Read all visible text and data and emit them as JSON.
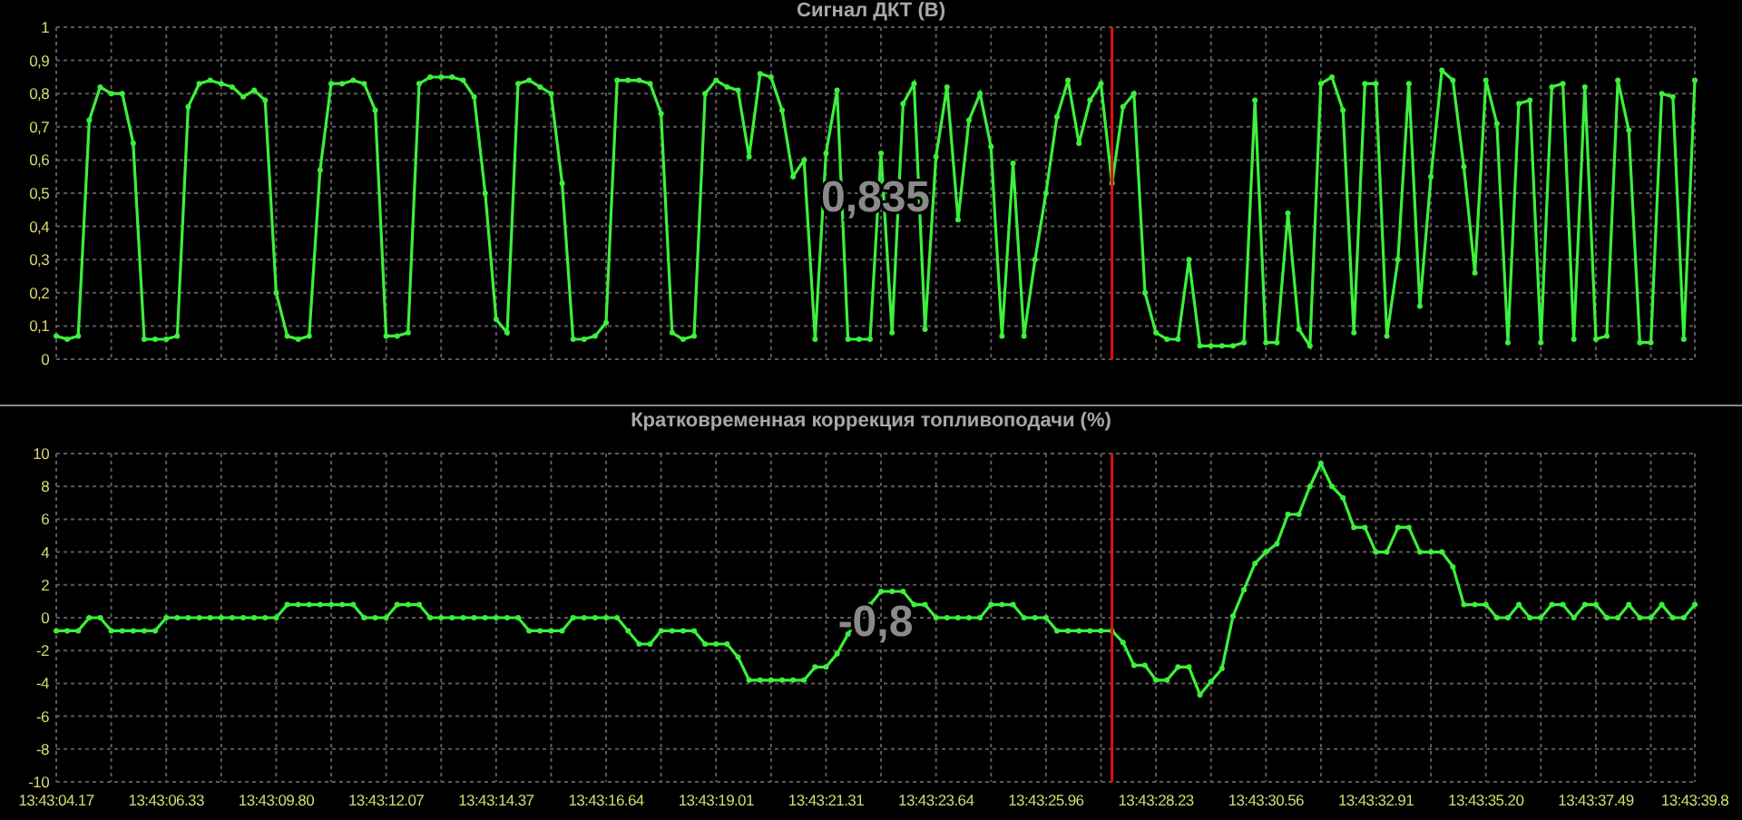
{
  "panels": [
    {
      "readout": "0,835",
      "chart_data": {
        "type": "line",
        "title": "Сигнал ДКТ (В)",
        "grid": true,
        "ylim": [
          0,
          1
        ],
        "yticks": [
          {
            "value": 0,
            "label": "0"
          },
          {
            "value": 0.1,
            "label": "0,1"
          },
          {
            "value": 0.2,
            "label": "0,2"
          },
          {
            "value": 0.3,
            "label": "0,3"
          },
          {
            "value": 0.4,
            "label": "0,4"
          },
          {
            "value": 0.5,
            "label": "0,5"
          },
          {
            "value": 0.6,
            "label": "0,6"
          },
          {
            "value": 0.7,
            "label": "0,7"
          },
          {
            "value": 0.8,
            "label": "0,8"
          },
          {
            "value": 0.9,
            "label": "0,9"
          },
          {
            "value": 1,
            "label": "1"
          }
        ],
        "series": [
          {
            "color": "#3cf03c",
            "marker": "circle",
            "values": [
              0.07,
              0.06,
              0.07,
              0.72,
              0.82,
              0.8,
              0.8,
              0.65,
              0.06,
              0.06,
              0.06,
              0.07,
              0.76,
              0.83,
              0.84,
              0.83,
              0.82,
              0.79,
              0.81,
              0.78,
              0.2,
              0.07,
              0.06,
              0.07,
              0.57,
              0.83,
              0.83,
              0.84,
              0.83,
              0.75,
              0.07,
              0.07,
              0.08,
              0.83,
              0.85,
              0.85,
              0.85,
              0.84,
              0.79,
              0.5,
              0.12,
              0.08,
              0.83,
              0.84,
              0.82,
              0.8,
              0.53,
              0.06,
              0.06,
              0.07,
              0.11,
              0.84,
              0.84,
              0.84,
              0.83,
              0.74,
              0.08,
              0.06,
              0.07,
              0.8,
              0.84,
              0.82,
              0.81,
              0.61,
              0.86,
              0.85,
              0.75,
              0.55,
              0.6,
              0.06,
              0.62,
              0.81,
              0.06,
              0.06,
              0.06,
              0.62,
              0.08,
              0.77,
              0.83,
              0.09,
              0.61,
              0.82,
              0.42,
              0.72,
              0.8,
              0.64,
              0.07,
              0.59,
              0.07,
              0.3,
              0.5,
              0.73,
              0.84,
              0.65,
              0.78,
              0.83,
              0.53,
              0.76,
              0.8,
              0.2,
              0.08,
              0.06,
              0.06,
              0.3,
              0.04,
              0.04,
              0.04,
              0.04,
              0.05,
              0.78,
              0.05,
              0.05,
              0.44,
              0.09,
              0.04,
              0.83,
              0.85,
              0.75,
              0.08,
              0.83,
              0.83,
              0.07,
              0.3,
              0.83,
              0.16,
              0.55,
              0.87,
              0.84,
              0.58,
              0.26,
              0.84,
              0.71,
              0.05,
              0.77,
              0.78,
              0.05,
              0.82,
              0.83,
              0.06,
              0.82,
              0.06,
              0.07,
              0.84,
              0.69,
              0.05,
              0.05,
              0.8,
              0.79,
              0.06,
              0.84
            ]
          }
        ]
      }
    },
    {
      "readout": "-0,8",
      "chart_data": {
        "type": "line",
        "title": "Кратковременная коррекция топливоподачи  (%)",
        "grid": true,
        "ylim": [
          -10,
          10
        ],
        "categories": [
          "13:43:04.17",
          null,
          null,
          null,
          null,
          null,
          null,
          null,
          null,
          null,
          "13:43:06.33",
          null,
          null,
          null,
          null,
          null,
          null,
          null,
          null,
          null,
          "13:43:09.80",
          null,
          null,
          null,
          null,
          null,
          null,
          null,
          null,
          null,
          "13:43:12.07",
          null,
          null,
          null,
          null,
          null,
          null,
          null,
          null,
          null,
          "13:43:14.37",
          null,
          null,
          null,
          null,
          null,
          null,
          null,
          null,
          null,
          "13:43:16.64",
          null,
          null,
          null,
          null,
          null,
          null,
          null,
          null,
          null,
          "13:43:19.01",
          null,
          null,
          null,
          null,
          null,
          null,
          null,
          null,
          null,
          "13:43:21.31",
          null,
          null,
          null,
          null,
          null,
          null,
          null,
          null,
          null,
          "13:43:23.64",
          null,
          null,
          null,
          null,
          null,
          null,
          null,
          null,
          null,
          "13:43:25.96",
          null,
          null,
          null,
          null,
          null,
          null,
          null,
          null,
          null,
          "13:43:28.23",
          null,
          null,
          null,
          null,
          null,
          null,
          null,
          null,
          null,
          "13:43:30.56",
          null,
          null,
          null,
          null,
          null,
          null,
          null,
          null,
          null,
          "13:43:32.91",
          null,
          null,
          null,
          null,
          null,
          null,
          null,
          null,
          null,
          "13:43:35.20",
          null,
          null,
          null,
          null,
          null,
          null,
          null,
          null,
          null,
          "13:43:37.49",
          null,
          null,
          null,
          null,
          null,
          null,
          null,
          null,
          "13:43:39.8"
        ],
        "yticks": [
          10,
          8,
          6,
          4,
          2,
          0,
          -2,
          -4,
          -6,
          -8,
          -10
        ],
        "series": [
          {
            "color": "#3cf03c",
            "marker": "circle",
            "values": [
              -0.8,
              -0.8,
              -0.8,
              0,
              0,
              -0.8,
              -0.8,
              -0.8,
              -0.8,
              -0.8,
              0,
              0,
              0,
              0,
              0,
              0,
              0,
              0,
              0,
              0,
              0,
              0.8,
              0.8,
              0.8,
              0.8,
              0.8,
              0.8,
              0.8,
              0,
              0,
              0,
              0.8,
              0.8,
              0.8,
              0,
              0,
              0,
              0,
              0,
              0,
              0,
              0,
              0,
              -0.8,
              -0.8,
              -0.8,
              -0.8,
              0,
              0,
              0,
              0,
              0,
              -0.8,
              -1.6,
              -1.6,
              -0.8,
              -0.8,
              -0.8,
              -0.8,
              -1.6,
              -1.6,
              -1.6,
              -2.4,
              -3.8,
              -3.8,
              -3.8,
              -3.8,
              -3.8,
              -3.8,
              -3,
              -3,
              -2.2,
              -1,
              0,
              0.8,
              1.6,
              1.6,
              1.6,
              0.8,
              0.8,
              0,
              0,
              0,
              0,
              0,
              0.8,
              0.8,
              0.8,
              0,
              0,
              0,
              -0.8,
              -0.8,
              -0.8,
              -0.8,
              -0.8,
              -0.8,
              -1.5,
              -2.9,
              -2.9,
              -3.8,
              -3.8,
              -3,
              -3,
              -4.7,
              -3.9,
              -3.1,
              0.1,
              1.7,
              3.3,
              4,
              4.5,
              6.3,
              6.3,
              8,
              9.4,
              8,
              7.3,
              5.5,
              5.5,
              4,
              4,
              5.5,
              5.5,
              4,
              4,
              4,
              3.1,
              0.8,
              0.8,
              0.8,
              0,
              0,
              0.8,
              0,
              0,
              0.8,
              0.8,
              0,
              0.8,
              0.8,
              0,
              0,
              0.8,
              0,
              0,
              0.8,
              0,
              0,
              0.8
            ]
          }
        ]
      }
    }
  ]
}
